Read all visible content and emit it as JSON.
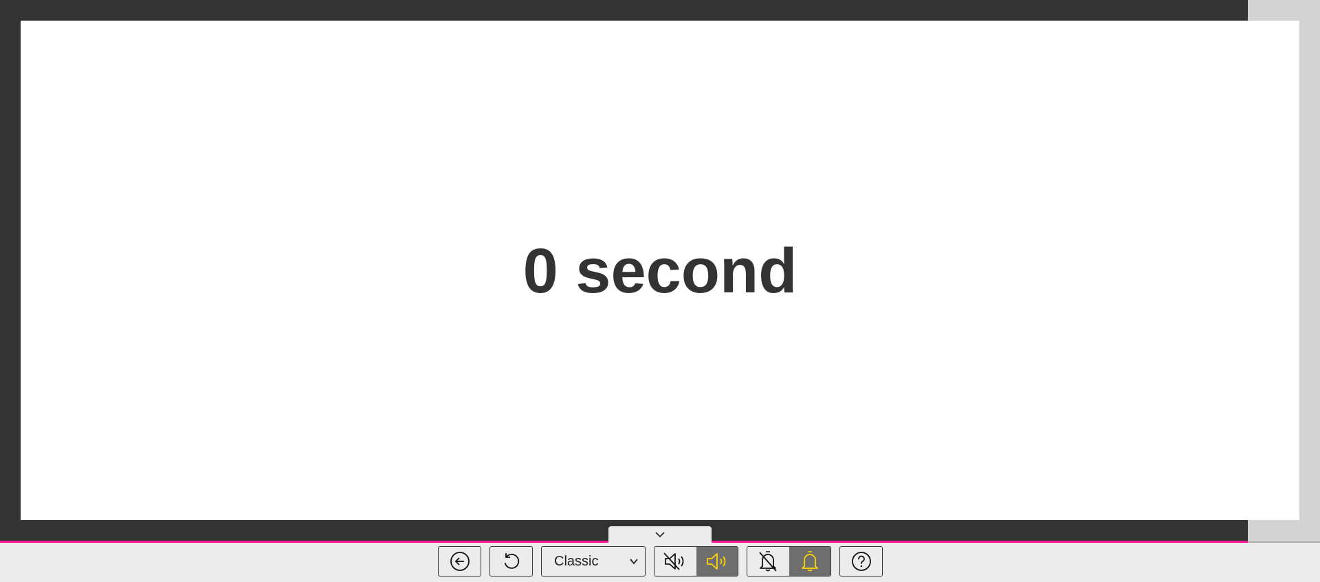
{
  "timer": {
    "display": "0 second"
  },
  "toolbar": {
    "back_icon": "arrow-left-circle-icon",
    "reset_icon": "rotate-ccw-icon",
    "theme_select": {
      "selected": "Classic"
    },
    "sound": {
      "mute_icon": "volume-mute-icon",
      "on_icon": "volume-on-icon",
      "active": "on"
    },
    "alarm": {
      "off_icon": "bell-off-icon",
      "on_icon": "bell-icon",
      "active": "on"
    },
    "help_icon": "help-circle-icon"
  },
  "colors": {
    "stage_background": "#333333",
    "panel_background": "#ffffff",
    "accent_line": "#ff1493",
    "active_icon": "#ffd700",
    "active_segment": "#6e6e6e",
    "toolbar_background": "#ececec"
  }
}
